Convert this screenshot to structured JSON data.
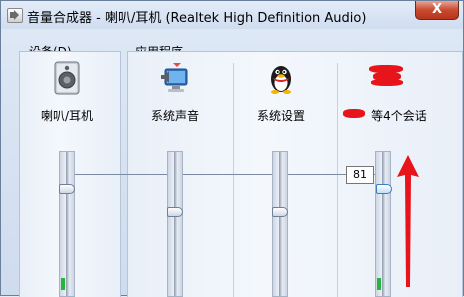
{
  "window": {
    "title": "音量合成器 - 喇叭/耳机 (Realtek High Definition Audio)",
    "close_symbol": "X"
  },
  "sections": {
    "device_label": "设备(D)",
    "apps_label": "应用程序"
  },
  "device": {
    "label": "喇叭/耳机",
    "icon": "speaker-icon",
    "volume": 81,
    "peak_level": 0.08
  },
  "apps": [
    {
      "label": "系统声音",
      "icon": "system-sounds-icon",
      "volume": 63,
      "peak_level": 0
    },
    {
      "label": "系统设置",
      "icon": "qq-penguin-icon",
      "volume": 63,
      "peak_level": 0
    },
    {
      "label": "等4个会话",
      "icon": "redacted-app-icon",
      "volume": 81,
      "peak_level": 0.08
    }
  ],
  "volume_tooltip": "81",
  "colors": {
    "meter_green": "#27b43a",
    "annotation_red": "#e8141b"
  }
}
